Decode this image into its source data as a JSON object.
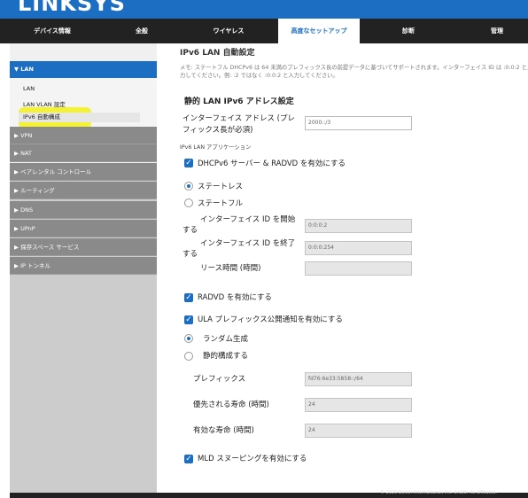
{
  "header": {
    "brand": "LINKSYS"
  },
  "nav": {
    "tabs": [
      {
        "label": "デバイス情報"
      },
      {
        "label": "全般"
      },
      {
        "label": "ワイヤレス"
      },
      {
        "label": "高度なセットアップ"
      },
      {
        "label": "診断"
      },
      {
        "label": "管理"
      }
    ],
    "active_tab": "高度なセットアップ"
  },
  "sidebar": {
    "lan": {
      "label": "LAN",
      "items": [
        "LAN",
        "LAN VLAN 設定",
        "IPv6 自動構成"
      ],
      "selected": "IPv6 自動構成"
    },
    "sections": [
      "VPN",
      "NAT",
      "ペアレンタル コントロール",
      "ルーティング",
      "DNS",
      "UPnP",
      "保存スペース サービス",
      "IP トンネル"
    ]
  },
  "main": {
    "cut_title": "IPv6 LAN 自動設定",
    "memo_line1": "メモ: ステートフル DHCPv6 は 64 未満のプレフィックス長の前提データに基づいてサポートされます。インターフェイス ID は :0:0:2 と入",
    "memo_line2": "力してください。例: :2 ではなく :0:0:2 と入力してください。",
    "static_title": "静的 LAN IPv6 アドレス設定",
    "iface_label_1": "インターフェイス アドレス (プレ",
    "iface_label_2": "フィックス長が必須)",
    "iface_value": "2000::/3",
    "app_label": "IPv6 LAN アプリケーション",
    "dhcp_label": "DHCPv6 サーバー & RADVD を有効にする",
    "stateless_label": "ステートレス",
    "stateful_label": "ステートフル",
    "start_label_1": "インターフェイス ID を開始",
    "start_label_2": "する",
    "start_value": "0:0:0:2",
    "end_label_1": "インターフェイス ID を終了",
    "end_label_2": "する",
    "end_value": "0:0:0:254",
    "lease_label": "リース時間 (時間)",
    "lease_value": "",
    "radvd_label": "RADVD を有効にする",
    "ula_label": "ULA プレフィックス公開通知を有効にする",
    "random_label": "ランダム生成",
    "static_cfg_label": "静的構成する",
    "prefix_label": "プレフィックス",
    "prefix_value": "fd76:6e33:5858::/64",
    "preferred_label": "優先される寿命 (時間)",
    "preferred_value": "24",
    "valid_label": "有効な寿命 (時間)",
    "valid_value": "24",
    "mld_label": "MLD スヌーピングを有効にする"
  },
  "footer": {
    "copyright": "© 2020 Belkin International, Inc. and/or its affiliates."
  },
  "colors": {
    "brand_blue": "#1c6ec2",
    "nav_bg": "#222222",
    "sidebar_bg": "#8a8a8a",
    "highlight": "#f4f21e"
  }
}
